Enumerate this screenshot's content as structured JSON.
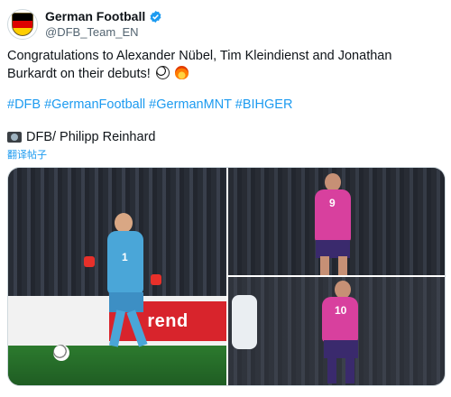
{
  "author": {
    "display_name": "German Football",
    "handle": "@DFB_Team_EN",
    "avatar_icon": "dfb-crest-icon",
    "verified_icon": "verified-badge-icon",
    "verified_color": "#1d9bf0"
  },
  "tweet": {
    "text": "Congratulations to Alexander Nübel, Tim Kleindienst and Jonathan Burkardt on their debuts!",
    "emojis": [
      "soccer-ball-icon",
      "fire-icon"
    ],
    "hashtags": [
      "#DFB",
      "#GermanFootball",
      "#GermanMNT",
      "#BIHGER"
    ],
    "credit": "DFB/ Philipp Reinhard",
    "credit_icon": "camera-icon",
    "translate_label": "翻译帖子"
  },
  "media": {
    "photos": [
      {
        "name": "goalkeeper-photo",
        "board_text": "rend",
        "jersey_number": "1"
      },
      {
        "name": "player-9-photo",
        "jersey_number": "9"
      },
      {
        "name": "player-10-photo",
        "jersey_number": "10"
      }
    ]
  },
  "colors": {
    "link": "#1d9bf0",
    "text": "#0f1419",
    "muted": "#536471"
  }
}
